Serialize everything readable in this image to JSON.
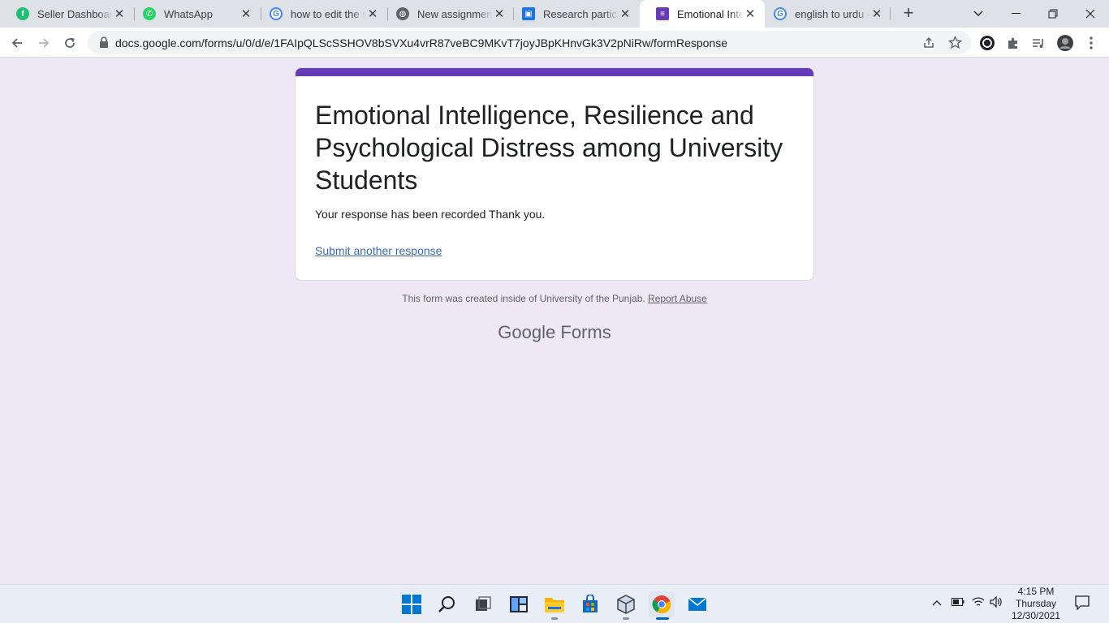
{
  "browser": {
    "tabs": [
      {
        "title": "Seller Dashboard",
        "favicon": "fiverr-icon",
        "color": "#1dbf73",
        "active": false
      },
      {
        "title": "WhatsApp",
        "favicon": "whatsapp-icon",
        "color": "#25d366",
        "active": false
      },
      {
        "title": "how to edit the s",
        "favicon": "google-icon",
        "color": "#4285f4",
        "active": false
      },
      {
        "title": "New assignment",
        "favicon": "globe-icon",
        "color": "#5f6368",
        "active": false
      },
      {
        "title": "Research particip",
        "favicon": "contact-form-icon",
        "color": "#1a73e8",
        "active": false
      },
      {
        "title": "Emotional Intellig",
        "favicon": "google-forms-icon",
        "color": "#673ab7",
        "active": true
      },
      {
        "title": "english to urdu -",
        "favicon": "google-icon",
        "color": "#4285f4",
        "active": false
      }
    ],
    "url": "docs.google.com/forms/u/0/d/e/1FAIpQLScSSHOV8bSVXu4vrR87veBC9MKvT7joyJBpKHnvGk3V2pNiRw/formResponse"
  },
  "form": {
    "title": "Emotional Intelligence, Resilience and Psychological Distress among University Students",
    "confirmation": "Your response has been recorded Thank you.",
    "submit_another": "Submit another response",
    "footer_text": "This form was created inside of University of the Punjab.",
    "report_abuse": "Report Abuse",
    "brand_google": "Google",
    "brand_forms": "Forms",
    "accent_color": "#673ab7"
  },
  "taskbar": {
    "time": "4:15 PM",
    "day": "Thursday",
    "date": "12/30/2021"
  }
}
